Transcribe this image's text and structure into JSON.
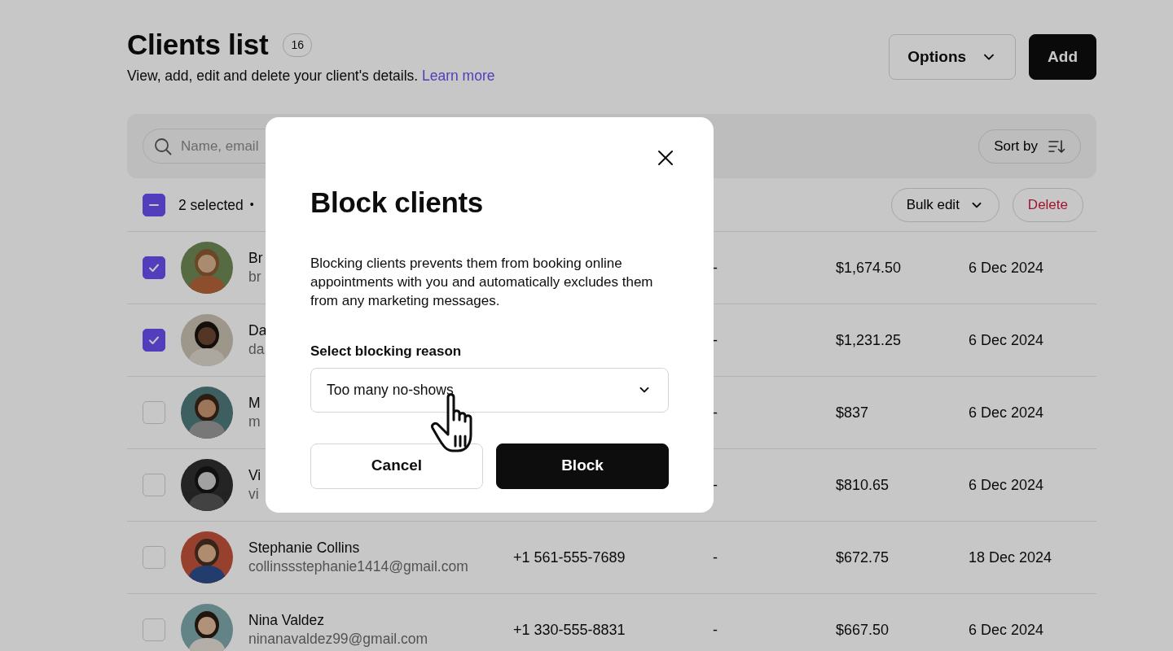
{
  "header": {
    "title": "Clients list",
    "count": "16",
    "subtitle": "View, add, edit and delete your client's details.",
    "link": "Learn more"
  },
  "actions": [
    {
      "label": "Options",
      "kind": "dropdown"
    },
    {
      "label": "Add",
      "kind": "primary"
    }
  ],
  "search": {
    "placeholder": "Name, email"
  },
  "sort": {
    "label": "Sort by"
  },
  "selection": {
    "indeterminate": true,
    "label": "2 selected",
    "separator": "•"
  },
  "bulk_actions": [
    {
      "label": "Bulk edit",
      "kind": "dropdown"
    },
    {
      "label": "Delete",
      "kind": "danger"
    }
  ],
  "rows": [
    {
      "checked": true,
      "name": "Br",
      "email": "br",
      "column_4": "-",
      "column_5": "$1,674.50",
      "column_6": "6 Dec 2024"
    },
    {
      "checked": true,
      "name": "Da",
      "email": "da",
      "column_4": "-",
      "column_5": "$1,231.25",
      "column_6": "6 Dec 2024"
    },
    {
      "checked": false,
      "name": "M",
      "email": "m",
      "column_4": "-",
      "column_5": "$837",
      "column_6": "6 Dec 2024"
    },
    {
      "checked": false,
      "name": "Vi",
      "email": "vi",
      "column_4": "-",
      "column_5": "$810.65",
      "column_6": "6 Dec 2024"
    },
    {
      "checked": false,
      "name": "Stephanie Collins",
      "email": "collinssstephanie1414@gmail.com",
      "column_3": "+1 561-555-7689",
      "column_4": "-",
      "column_5": "$672.75",
      "column_6": "18 Dec 2024"
    },
    {
      "checked": false,
      "name": "Nina Valdez",
      "email": "ninanavaldez99@gmail.com",
      "column_3": "+1 330-555-8831",
      "column_4": "-",
      "column_5": "$667.50",
      "column_6": "6 Dec 2024"
    }
  ],
  "modal": {
    "title": "Block clients",
    "body": "Blocking clients prevents them from booking online appointments with you and automatically excludes them from any marketing messages.",
    "field_label": "Select blocking reason",
    "select_value": "Too many no-shows",
    "buttons": [
      {
        "label": "Cancel",
        "kind": "secondary"
      },
      {
        "label": "Block",
        "kind": "primary"
      }
    ]
  }
}
